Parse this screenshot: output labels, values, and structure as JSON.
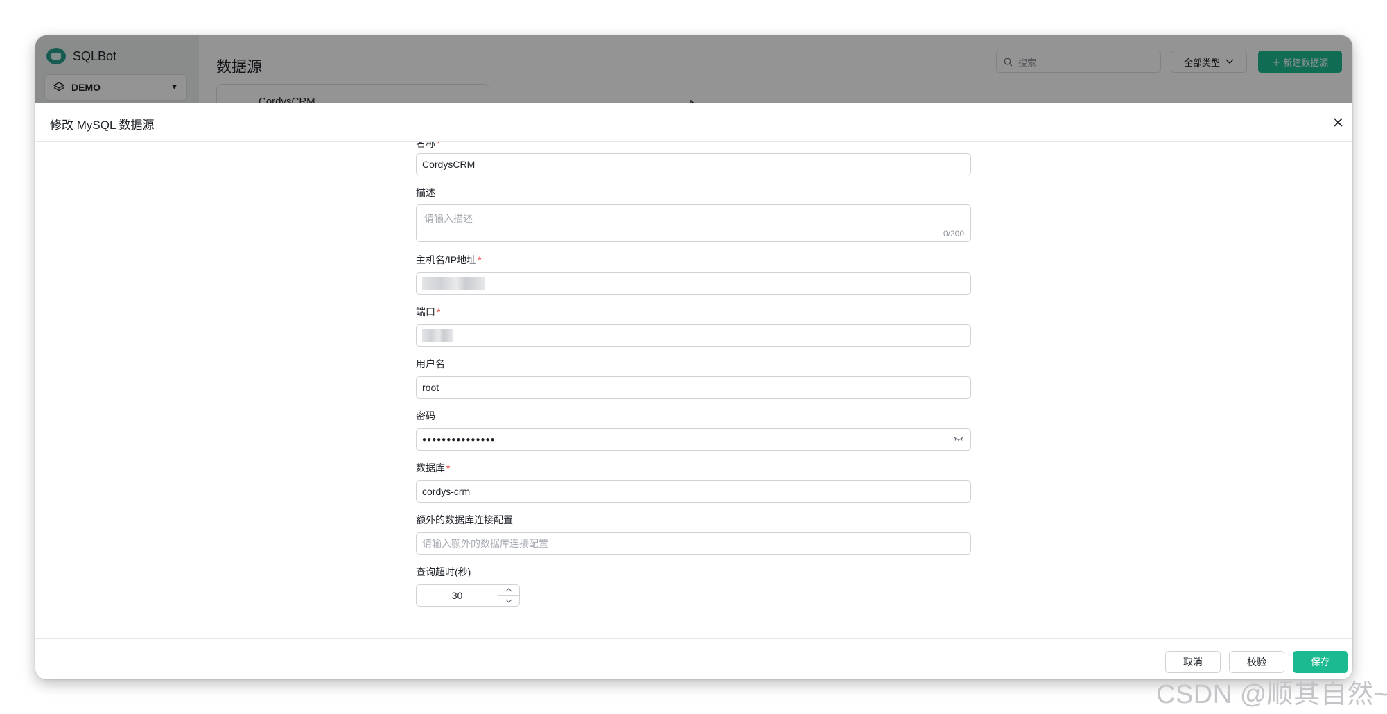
{
  "background": {
    "app_name": "SQLBot",
    "workspace": "DEMO",
    "page_title": "数据源",
    "search_placeholder": "搜索",
    "filter_label": "全部类型",
    "new_button": "＋ 新建数据源",
    "card_name": "CordysCRM"
  },
  "drawer": {
    "title": "修改 MySQL 数据源",
    "fields": {
      "name": {
        "label": "名称",
        "value": "CordysCRM"
      },
      "description": {
        "label": "描述",
        "placeholder": "请输入描述",
        "counter": "0/200"
      },
      "host": {
        "label": "主机名/IP地址"
      },
      "port": {
        "label": "端口"
      },
      "username": {
        "label": "用户名",
        "value": "root"
      },
      "password": {
        "label": "密码",
        "value": "●●●●●●●●●●●●●●●"
      },
      "database": {
        "label": "数据库",
        "value": "cordys-crm"
      },
      "extra": {
        "label": "额外的数据库连接配置",
        "placeholder": "请输入额外的数据库连接配置"
      },
      "timeout": {
        "label": "查询超时(秒)",
        "value": "30"
      }
    },
    "required_mark": "*",
    "footer": {
      "cancel": "取消",
      "validate": "校验",
      "save": "保存"
    }
  },
  "watermark": "CSDN @顺其自然~",
  "colors": {
    "primary": "#1cba90",
    "required": "#f54a45"
  }
}
